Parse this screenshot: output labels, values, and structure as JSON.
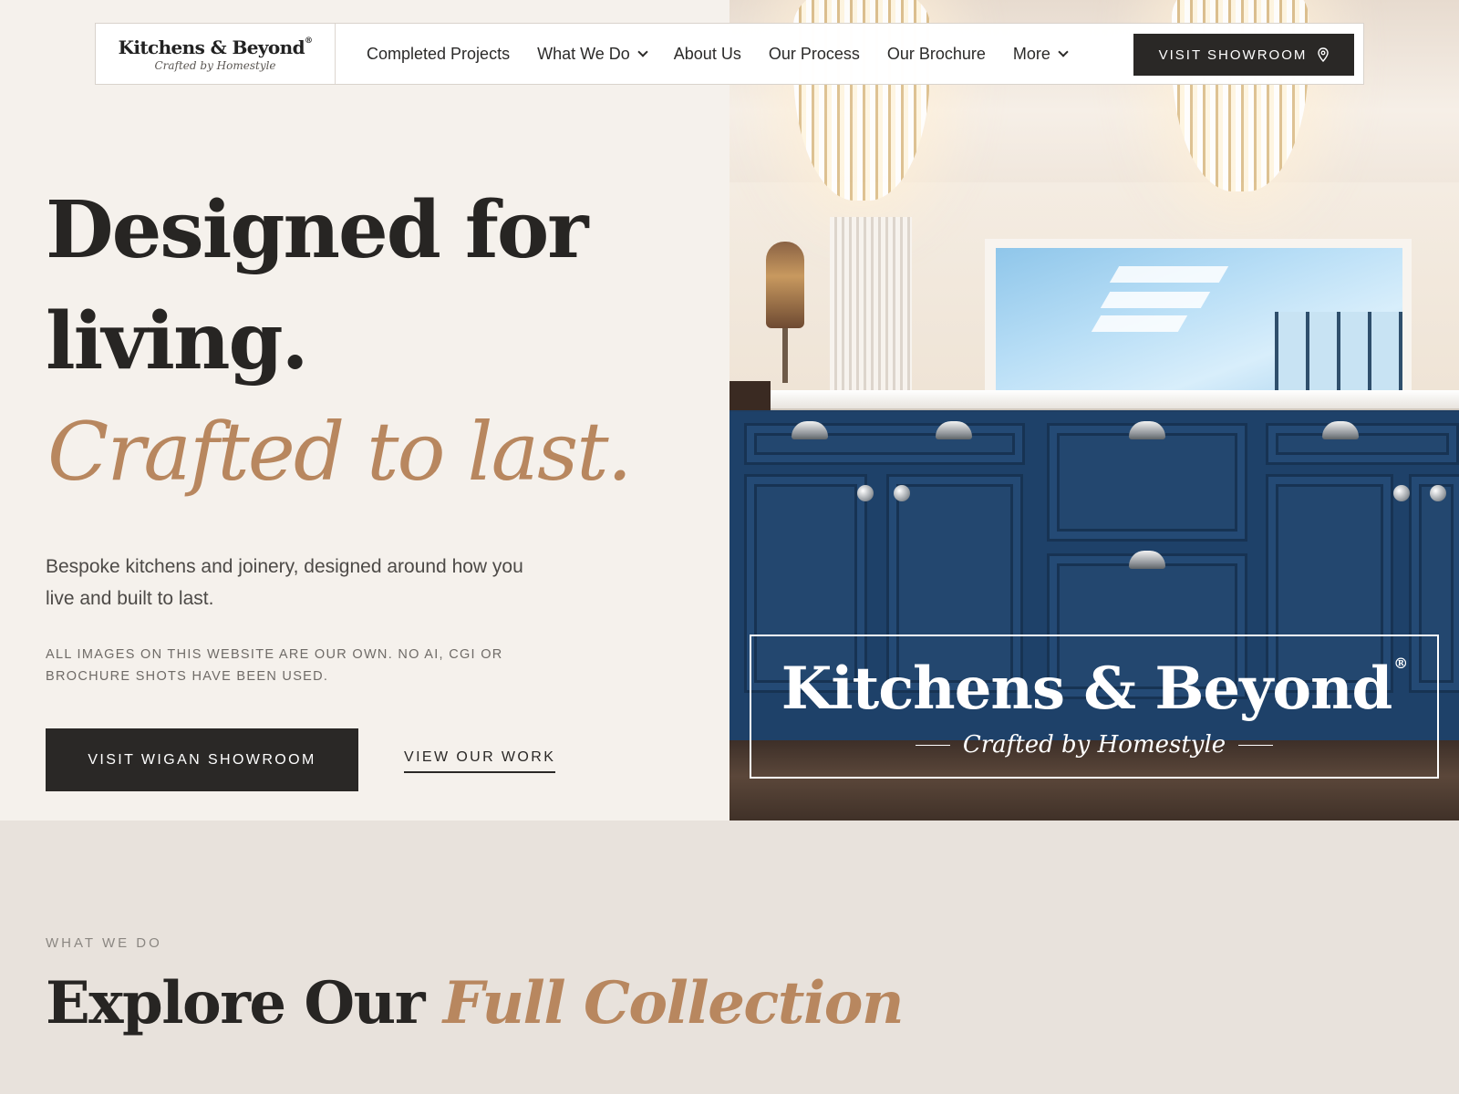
{
  "brand": {
    "name": "Kitchens & Beyond",
    "reg_mark": "®",
    "tagline": "Crafted by Homestyle"
  },
  "nav": {
    "links": [
      {
        "label": "Completed Projects",
        "has_dropdown": false
      },
      {
        "label": "What We Do",
        "has_dropdown": true
      },
      {
        "label": "About Us",
        "has_dropdown": false
      },
      {
        "label": "Our Process",
        "has_dropdown": false
      },
      {
        "label": "Our Brochure",
        "has_dropdown": false
      },
      {
        "label": "More",
        "has_dropdown": true
      }
    ],
    "cta_label": "VISIT SHOWROOM",
    "cta_icon": "map-pin-icon"
  },
  "hero": {
    "heading_line1": "Designed for",
    "heading_line2": "living.",
    "heading_accent": "Crafted to last.",
    "lead": "Bespoke kitchens and joinery, designed around how you live and built to last.",
    "disclaimer": "ALL IMAGES ON THIS WEBSITE ARE OUR OWN. NO AI, CGI OR BROCHURE SHOTS HAVE BEEN USED.",
    "primary_button": "VISIT WIGAN SHOWROOM",
    "secondary_link": "VIEW OUR WORK"
  },
  "section": {
    "eyebrow": "WHAT WE DO",
    "title_plain": "Explore Our ",
    "title_accent": "Full Collection"
  },
  "colors": {
    "accent": "#b8875f",
    "dark": "#2a2826",
    "hero_bg": "#f5f1ec",
    "section_bg": "#e8e2dc",
    "cabinet_blue": "#1e4169"
  }
}
